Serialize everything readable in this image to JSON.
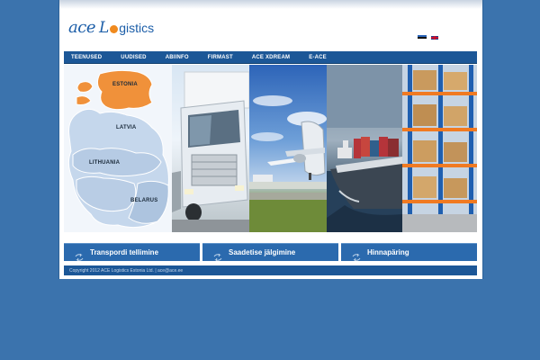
{
  "logo": {
    "part1": "ace",
    "part2": "L",
    "part3": "gistics"
  },
  "languages": [
    {
      "code": "et",
      "icon": "estonia-flag-icon"
    },
    {
      "code": "en",
      "icon": "uk-flag-icon"
    }
  ],
  "nav": {
    "items": [
      "TEENUSED",
      "UUDISED",
      "ABIINFO",
      "FIRMAST",
      "ACE XDREAM",
      "E-ACE"
    ]
  },
  "hero": {
    "map_labels": {
      "estonia": "ESTONIA",
      "latvia": "LATVIA",
      "lithuania": "LITHUANIA",
      "belarus": "BELARUS"
    }
  },
  "actions": [
    {
      "label": "Transpordi tellimine",
      "icon": "refresh-arrows-icon"
    },
    {
      "label": "Saadetise jälgimine",
      "icon": "refresh-arrows-icon"
    },
    {
      "label": "Hinnapäring",
      "icon": "refresh-arrows-icon"
    }
  ],
  "footer": {
    "text": "Copyright 2012 ACE Logistics Estonia Ltd. | ace@ace.ee"
  },
  "colors": {
    "background": "#3b73ad",
    "nav": "#1c5797",
    "button": "#2b6aae",
    "estonia_highlight": "#f0913a",
    "logo_blue": "#1c5ea8",
    "logo_orange": "#f08a1e"
  }
}
